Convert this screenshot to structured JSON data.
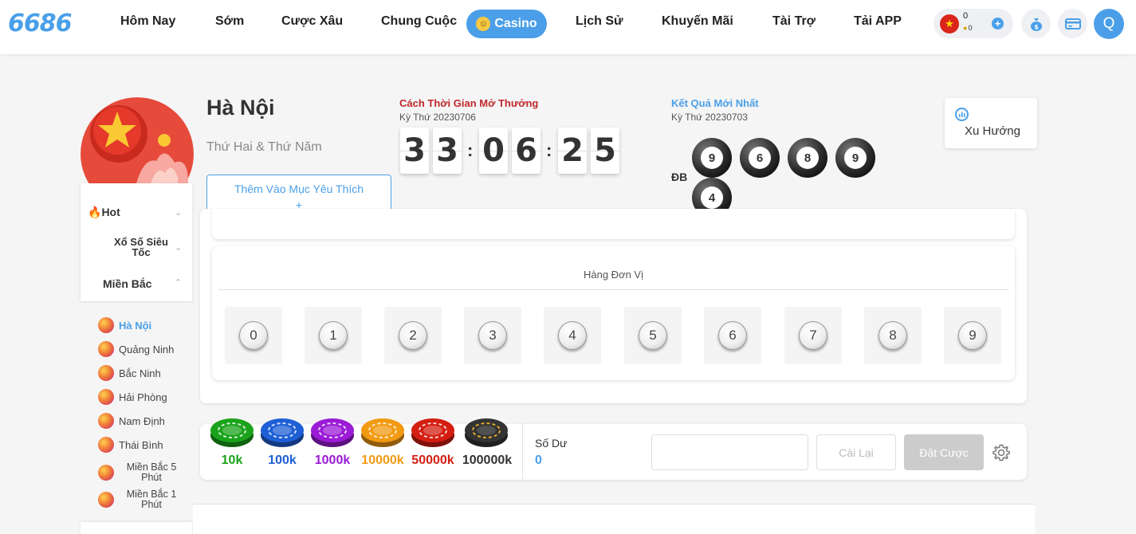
{
  "brand": {
    "logo": "6686"
  },
  "nav": {
    "items": [
      "Hôm Nay",
      "Sớm",
      "Cược Xâu",
      "Chung Cuộc",
      "Lịch Sử",
      "Khuyến Mãi",
      "Tài Trợ",
      "Tải APP"
    ],
    "casino": "Casino"
  },
  "wallet": {
    "balance": "0",
    "coin_balance": "0"
  },
  "user": {
    "initial": "Q"
  },
  "lottery": {
    "title": "Hà Nội",
    "schedule": "Thứ Hai & Thứ Năm",
    "favorite_label_line1": "Thêm Vào Mục Yêu Thích",
    "favorite_label_line2": "+"
  },
  "countdown": {
    "title": "Cách Thời Gian Mở Thưởng",
    "period": "Kỳ Thứ 20230706",
    "digits": [
      "3",
      "3",
      "0",
      "6",
      "2",
      "5"
    ],
    "separator": ":"
  },
  "latest_result": {
    "title": "Kết Quả Mới Nhất",
    "period": "Kỳ Thứ 20230703",
    "label": "ĐB",
    "balls": [
      "9",
      "6",
      "8",
      "9",
      "4"
    ]
  },
  "trend": {
    "label": "Xu Hướng"
  },
  "sidebar": {
    "categories": [
      "Hot",
      "Xổ Số Siêu Tốc",
      "Miền Bắc"
    ],
    "items": [
      "Hà Nội",
      "Quảng Ninh",
      "Bắc Ninh",
      "Hải Phòng",
      "Nam Định",
      "Thái Bình",
      "Miền Bắc 5 Phút",
      "Miền Bắc 1 Phút"
    ],
    "active": "Hà Nội"
  },
  "board": {
    "card_title": "Hàng Đơn Vị",
    "numbers": [
      "0",
      "1",
      "2",
      "3",
      "4",
      "5",
      "6",
      "7",
      "8",
      "9"
    ]
  },
  "bet": {
    "chips": [
      {
        "label": "10k",
        "color": "#1aa31a"
      },
      {
        "label": "100k",
        "color": "#1e5fd6"
      },
      {
        "label": "1000k",
        "color": "#9b1bd6"
      },
      {
        "label": "10000k",
        "color": "#f29a12"
      },
      {
        "label": "50000k",
        "color": "#d41e12"
      },
      {
        "label": "100000k",
        "color": "#333333"
      }
    ],
    "balance_label": "Số Dư",
    "balance_value": "0",
    "amount_placeholder": "",
    "reset_label": "Cài Lại",
    "place_label": "Đặt Cược"
  }
}
